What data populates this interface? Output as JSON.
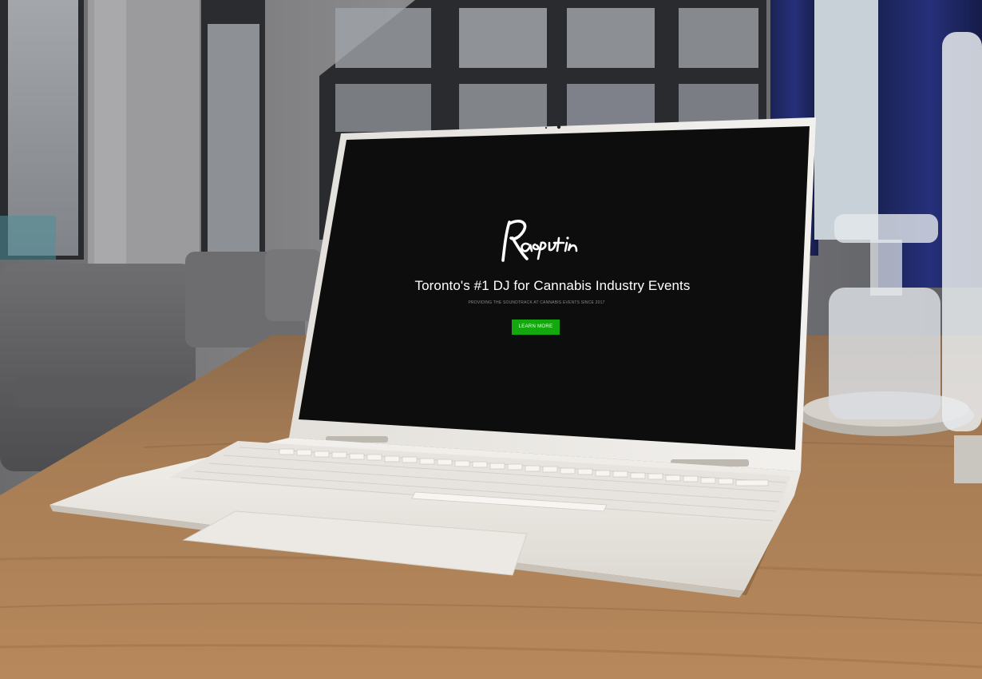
{
  "website": {
    "logo_text": "Rasputin",
    "headline": "Toronto's #1 DJ for Cannabis Industry Events",
    "subheadline": "PROVIDING THE SOUNDTRACK AT CANNABIS EVENTS SINCE 2017",
    "cta_label": "LEARN MORE"
  },
  "colors": {
    "cta_green": "#13a80d",
    "screen_bg": "#0d0d0d",
    "laptop_body": "#eeebe6",
    "table_wood": "#a8794f"
  },
  "icons": [
    "webcam-icon"
  ]
}
